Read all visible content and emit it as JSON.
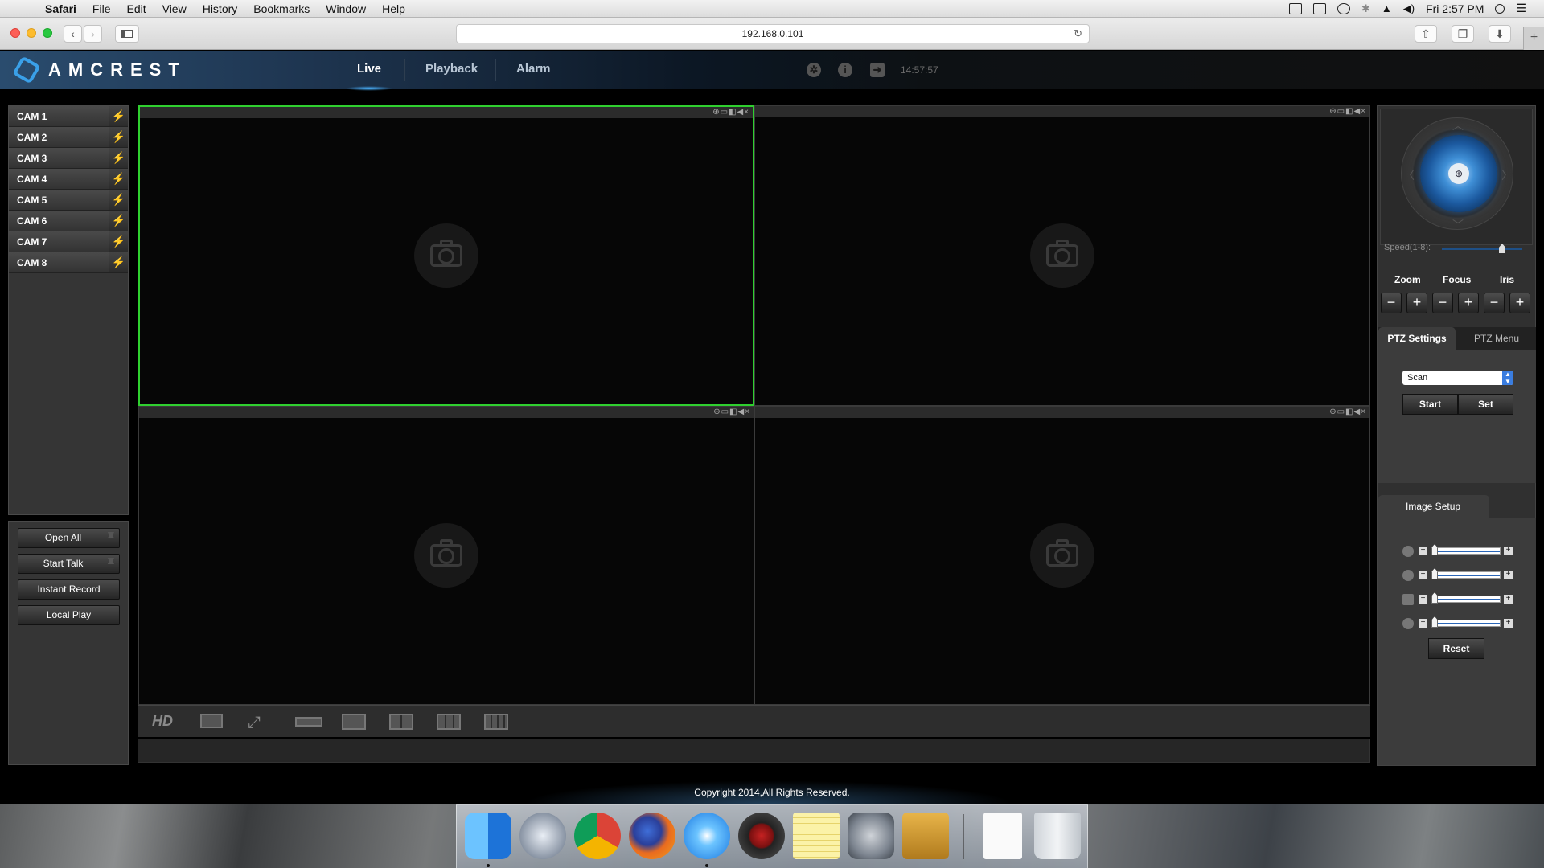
{
  "menubar": {
    "apple_icon": "apple-icon",
    "app_name": "Safari",
    "menus": [
      "File",
      "Edit",
      "View",
      "History",
      "Bookmarks",
      "Window",
      "Help"
    ],
    "clock": "Fri 2:57 PM"
  },
  "browser": {
    "url": "192.168.0.101",
    "new_tab_label": "+"
  },
  "app": {
    "brand": "AMCREST",
    "nav": [
      "Live",
      "Playback",
      "Alarm"
    ],
    "active_nav": "Live",
    "time": "14:57:57"
  },
  "cameras": [
    "CAM 1",
    "CAM 2",
    "CAM 3",
    "CAM 4",
    "CAM 5",
    "CAM 6",
    "CAM 7",
    "CAM 8"
  ],
  "left_controls": {
    "open_all": "Open All",
    "start_talk": "Start Talk",
    "instant_record": "Instant Record",
    "local_play": "Local Play"
  },
  "video": {
    "pane_controls": "⊕▭◧◀×",
    "bottom_hd": "HD"
  },
  "ptz": {
    "speed_label": "Speed(1-8):",
    "speed_value": 6,
    "speed_max": 8,
    "zoom": "Zoom",
    "focus": "Focus",
    "iris": "Iris",
    "minus": "−",
    "plus": "+",
    "tabs": [
      "PTZ Settings",
      "PTZ Menu"
    ],
    "mode_selected": "Scan",
    "start": "Start",
    "set": "Set"
  },
  "image_setup": {
    "title": "Image Setup",
    "sliders": [
      {
        "icon": "brightness-icon",
        "value": 0
      },
      {
        "icon": "contrast-icon",
        "value": 0
      },
      {
        "icon": "saturation-icon",
        "value": 0
      },
      {
        "icon": "hue-icon",
        "value": 0
      }
    ],
    "reset": "Reset"
  },
  "footer": {
    "copyright": "Copyright 2014,All Rights Reserved."
  },
  "colors": {
    "selected_pane_border": "#2fd02f",
    "accent_blue": "#3aa0e8"
  }
}
